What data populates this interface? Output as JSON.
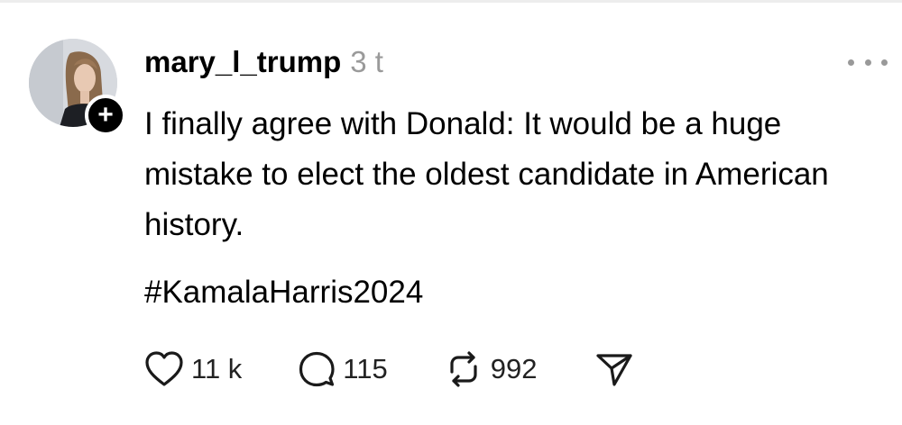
{
  "post": {
    "username": "mary_l_trump",
    "timestamp": "3 t",
    "text": "I finally agree with Donald: It would be a huge mistake to elect the oldest candidate in American history.",
    "hashtag": "#KamalaHarris2024"
  },
  "actions": {
    "like_count": "11 k",
    "reply_count": "115",
    "repost_count": "992"
  },
  "icons": {
    "follow": "plus-icon",
    "more": "more-horizontal-icon",
    "like": "heart-icon",
    "reply": "speech-bubble-icon",
    "repost": "repost-icon",
    "share": "send-icon"
  },
  "colors": {
    "text": "#000000",
    "muted": "#9a9a9a",
    "badge": "#000000"
  }
}
